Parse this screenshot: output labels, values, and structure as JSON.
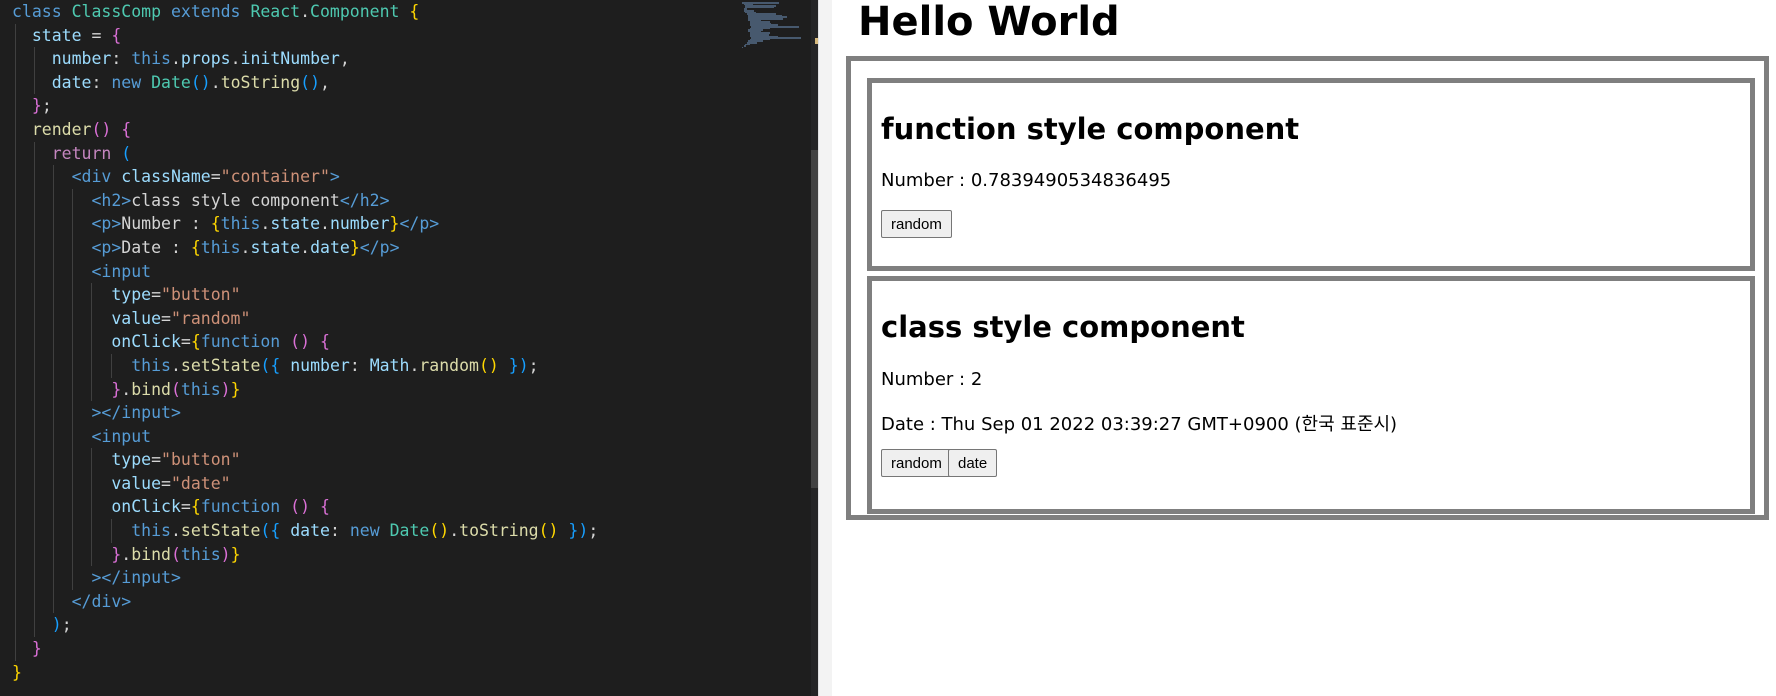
{
  "editor": {
    "lines": [
      [
        [
          "kw",
          "class "
        ],
        [
          "cls",
          "ClassComp "
        ],
        [
          "kw",
          "extends "
        ],
        [
          "cls",
          "React"
        ],
        [
          "",
          "."
        ],
        [
          "cls",
          "Component "
        ],
        [
          "b1",
          "{"
        ]
      ],
      [
        [
          "prop",
          "state "
        ],
        [
          "",
          "= "
        ],
        [
          "b2",
          "{"
        ]
      ],
      [
        [
          "prop",
          "number"
        ],
        [
          "",
          ": "
        ],
        [
          "kw",
          "this"
        ],
        [
          "",
          "."
        ],
        [
          "prop",
          "props"
        ],
        [
          "",
          "."
        ],
        [
          "prop",
          "initNumber"
        ],
        [
          "",
          ","
        ]
      ],
      [
        [
          "prop",
          "date"
        ],
        [
          "",
          ": "
        ],
        [
          "kw",
          "new "
        ],
        [
          "cls",
          "Date"
        ],
        [
          "b3",
          "()"
        ],
        [
          "",
          "."
        ],
        [
          "fn",
          "toString"
        ],
        [
          "b3",
          "()"
        ],
        [
          "",
          ","
        ]
      ],
      [
        [
          "b2",
          "}"
        ],
        [
          "",
          ";"
        ]
      ],
      [
        [
          "fn",
          "render"
        ],
        [
          "b2",
          "() {"
        ]
      ],
      [
        [
          "ctl",
          "return "
        ],
        [
          "b3",
          "("
        ]
      ],
      [
        [
          "tag",
          "<"
        ],
        [
          "tag",
          "div "
        ],
        [
          "prop",
          "className"
        ],
        [
          "",
          "="
        ],
        [
          "str",
          "\"container\""
        ],
        [
          "tag",
          ">"
        ]
      ],
      [
        [
          "tag",
          "<"
        ],
        [
          "tag",
          "h2"
        ],
        [
          "tag",
          ">"
        ],
        [
          "",
          "class style component"
        ],
        [
          "tag",
          "</"
        ],
        [
          "tag",
          "h2"
        ],
        [
          "tag",
          ">"
        ]
      ],
      [
        [
          "tag",
          "<"
        ],
        [
          "tag",
          "p"
        ],
        [
          "tag",
          ">"
        ],
        [
          "",
          "Number : "
        ],
        [
          "b1",
          "{"
        ],
        [
          "kw",
          "this"
        ],
        [
          "",
          "."
        ],
        [
          "prop",
          "state"
        ],
        [
          "",
          "."
        ],
        [
          "prop",
          "number"
        ],
        [
          "b1",
          "}"
        ],
        [
          "tag",
          "</"
        ],
        [
          "tag",
          "p"
        ],
        [
          "tag",
          ">"
        ]
      ],
      [
        [
          "tag",
          "<"
        ],
        [
          "tag",
          "p"
        ],
        [
          "tag",
          ">"
        ],
        [
          "",
          "Date : "
        ],
        [
          "b1",
          "{"
        ],
        [
          "kw",
          "this"
        ],
        [
          "",
          "."
        ],
        [
          "prop",
          "state"
        ],
        [
          "",
          "."
        ],
        [
          "prop",
          "date"
        ],
        [
          "b1",
          "}"
        ],
        [
          "tag",
          "</"
        ],
        [
          "tag",
          "p"
        ],
        [
          "tag",
          ">"
        ]
      ],
      [
        [
          "tag",
          "<"
        ],
        [
          "tag",
          "input"
        ]
      ],
      [
        [
          "prop",
          "type"
        ],
        [
          "",
          "="
        ],
        [
          "str",
          "\"button\""
        ]
      ],
      [
        [
          "prop",
          "value"
        ],
        [
          "",
          "="
        ],
        [
          "str",
          "\"random\""
        ]
      ],
      [
        [
          "prop",
          "onClick"
        ],
        [
          "",
          "="
        ],
        [
          "b1",
          "{"
        ],
        [
          "kw",
          "function "
        ],
        [
          "b2",
          "() {"
        ]
      ],
      [
        [
          "kw",
          "this"
        ],
        [
          "",
          "."
        ],
        [
          "fn",
          "setState"
        ],
        [
          "b3",
          "({ "
        ],
        [
          "prop",
          "number"
        ],
        [
          "",
          ": "
        ],
        [
          "prop",
          "Math"
        ],
        [
          "",
          "."
        ],
        [
          "fn",
          "random"
        ],
        [
          "b1",
          "()"
        ],
        [
          "b3",
          " })"
        ],
        [
          "",
          ";"
        ]
      ],
      [
        [
          "b2",
          "}"
        ],
        [
          "",
          "."
        ],
        [
          "fn",
          "bind"
        ],
        [
          "b2",
          "("
        ],
        [
          "kw",
          "this"
        ],
        [
          "b2",
          ")"
        ],
        [
          "b1",
          "}"
        ]
      ],
      [
        [
          "tag",
          ">"
        ],
        [
          "tag",
          "</"
        ],
        [
          "tag",
          "input"
        ],
        [
          "tag",
          ">"
        ]
      ],
      [
        [
          "tag",
          "<"
        ],
        [
          "tag",
          "input"
        ]
      ],
      [
        [
          "prop",
          "type"
        ],
        [
          "",
          "="
        ],
        [
          "str",
          "\"button\""
        ]
      ],
      [
        [
          "prop",
          "value"
        ],
        [
          "",
          "="
        ],
        [
          "str",
          "\"date\""
        ]
      ],
      [
        [
          "prop",
          "onClick"
        ],
        [
          "",
          "="
        ],
        [
          "b1",
          "{"
        ],
        [
          "kw",
          "function "
        ],
        [
          "b2",
          "() {"
        ]
      ],
      [
        [
          "kw",
          "this"
        ],
        [
          "",
          "."
        ],
        [
          "fn",
          "setState"
        ],
        [
          "b3",
          "({ "
        ],
        [
          "prop",
          "date"
        ],
        [
          "",
          ": "
        ],
        [
          "kw",
          "new "
        ],
        [
          "cls",
          "Date"
        ],
        [
          "b1",
          "()"
        ],
        [
          "",
          "."
        ],
        [
          "fn",
          "toString"
        ],
        [
          "b1",
          "()"
        ],
        [
          "b3",
          " })"
        ],
        [
          "",
          ";"
        ]
      ],
      [
        [
          "b2",
          "}"
        ],
        [
          "",
          "."
        ],
        [
          "fn",
          "bind"
        ],
        [
          "b2",
          "("
        ],
        [
          "kw",
          "this"
        ],
        [
          "b2",
          ")"
        ],
        [
          "b1",
          "}"
        ]
      ],
      [
        [
          "tag",
          ">"
        ],
        [
          "tag",
          "</"
        ],
        [
          "tag",
          "input"
        ],
        [
          "tag",
          ">"
        ]
      ],
      [
        [
          "tag",
          "</"
        ],
        [
          "tag",
          "div"
        ],
        [
          "tag",
          ">"
        ]
      ],
      [
        [
          "b3",
          ")"
        ],
        [
          "",
          ";"
        ]
      ],
      [
        [
          "b2",
          "}"
        ]
      ],
      [
        [
          "b1",
          "}"
        ]
      ]
    ],
    "indents": [
      0,
      1,
      2,
      2,
      1,
      1,
      2,
      3,
      4,
      4,
      4,
      4,
      5,
      5,
      5,
      6,
      5,
      4,
      4,
      5,
      5,
      5,
      6,
      5,
      4,
      3,
      2,
      1,
      0
    ]
  },
  "browser": {
    "heading": "Hello World",
    "function_component": {
      "title": "function style component",
      "number_text": "Number : 0.7839490534836495",
      "random_button": "random"
    },
    "class_component": {
      "title": "class style component",
      "number_text": "Number : 2",
      "date_text": "Date : Thu Sep 01 2022 03:39:27 GMT+0900 (한국 표준시)",
      "random_button": "random",
      "date_button": "date"
    }
  }
}
